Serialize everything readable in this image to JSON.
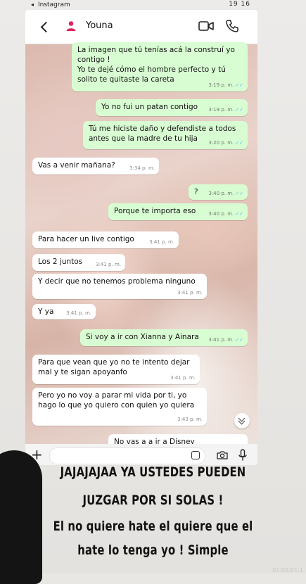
{
  "statusbar": {
    "app": "Instagram",
    "back": "◂",
    "time": "19 16"
  },
  "chat": {
    "contact_name": "Youna",
    "messages": [
      {
        "dir": "out",
        "text": "La imagen que tú tenías acá la construí yo contigo !\nYo te dejé cómo el hombre perfecto y tú solito te quitaste la careta",
        "time": "3:19 p. m."
      },
      {
        "dir": "out",
        "text": "Yo no fui un patan contigo",
        "time": "3:19 p. m."
      },
      {
        "dir": "out",
        "text": "Tú me hiciste daño y defendiste a todos antes que la madre de tu hija",
        "time": "3:20 p. m."
      },
      {
        "dir": "in",
        "text": "Vas a venir mañana?",
        "time": "3:34 p. m."
      },
      {
        "dir": "out",
        "text": "?",
        "time": "3:40 p. m."
      },
      {
        "dir": "out",
        "text": "Porque te importa eso",
        "time": "3:40 p. m."
      },
      {
        "dir": "in",
        "text": "Para hacer un live contigo",
        "time": "3:41 p. m."
      },
      {
        "dir": "in",
        "text": "Los 2 juntos",
        "time": "3:41 p. m."
      },
      {
        "dir": "in",
        "text": "Y decir que no tenemos problema ninguno",
        "time": "3:41 p. m."
      },
      {
        "dir": "in",
        "text": "Y ya",
        "time": "3:41 p. m."
      },
      {
        "dir": "out",
        "text": "Si voy a ir con Xianna y Ainara",
        "time": "3:41 p. m."
      },
      {
        "dir": "in",
        "text": "Para que vean que yo no te intento dejar mal y te sigan apoyanfo",
        "time": "3:41 p. m."
      },
      {
        "dir": "in",
        "text": "Pero yo no voy a parar mi vida por ti, yo hago lo que yo quiero con quien yo quiera",
        "time": "3:43 p. m."
      },
      {
        "dir": "in",
        "text": "No vas a a ir a Disney",
        "time": ""
      }
    ]
  },
  "caption": {
    "line1": "JAJAJAJAA YA USTEDES PUEDEN",
    "line2": "JUZGAR POR SI SOLAS !",
    "line3": "El no quiere hate el quiere que el",
    "line4": "hate lo tenga yo ! Simple"
  },
  "watermark": "01:03/01:1",
  "colors": {
    "outgoing_bubble": "#d9fdd3",
    "incoming_bubble": "#ffffff",
    "read_ticks": "#53bdeb"
  },
  "icons": [
    "back-arrow-icon",
    "contact-avatar-icon",
    "video-call-icon",
    "phone-icon",
    "plus-icon",
    "sticker-icon",
    "camera-icon",
    "mic-icon",
    "double-chevron-down-icon"
  ]
}
